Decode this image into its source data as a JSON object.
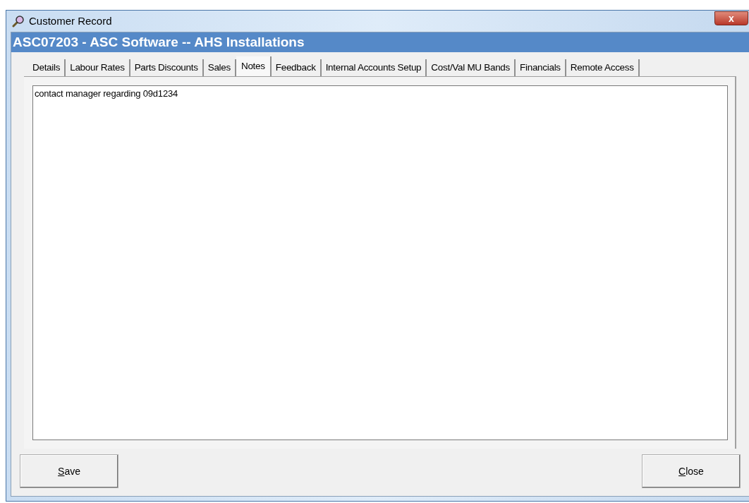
{
  "window": {
    "title": "Customer Record",
    "close_label": "x"
  },
  "header": {
    "title": "ASC07203 - ASC Software -- AHS Installations"
  },
  "tabs": [
    {
      "label": "Details",
      "selected": false
    },
    {
      "label": "Labour Rates",
      "selected": false
    },
    {
      "label": "Parts Discounts",
      "selected": false
    },
    {
      "label": "Sales",
      "selected": false
    },
    {
      "label": "Notes",
      "selected": true
    },
    {
      "label": "Feedback",
      "selected": false
    },
    {
      "label": "Internal Accounts Setup",
      "selected": false
    },
    {
      "label": "Cost/Val MU Bands",
      "selected": false
    },
    {
      "label": "Financials",
      "selected": false
    },
    {
      "label": "Remote Access",
      "selected": false
    }
  ],
  "notes": {
    "value": "contact manager regarding 09d1234"
  },
  "buttons": [
    {
      "label": "Save",
      "access_key_underlined": true
    },
    {
      "label": "Close",
      "access_key_underlined": true
    }
  ]
}
